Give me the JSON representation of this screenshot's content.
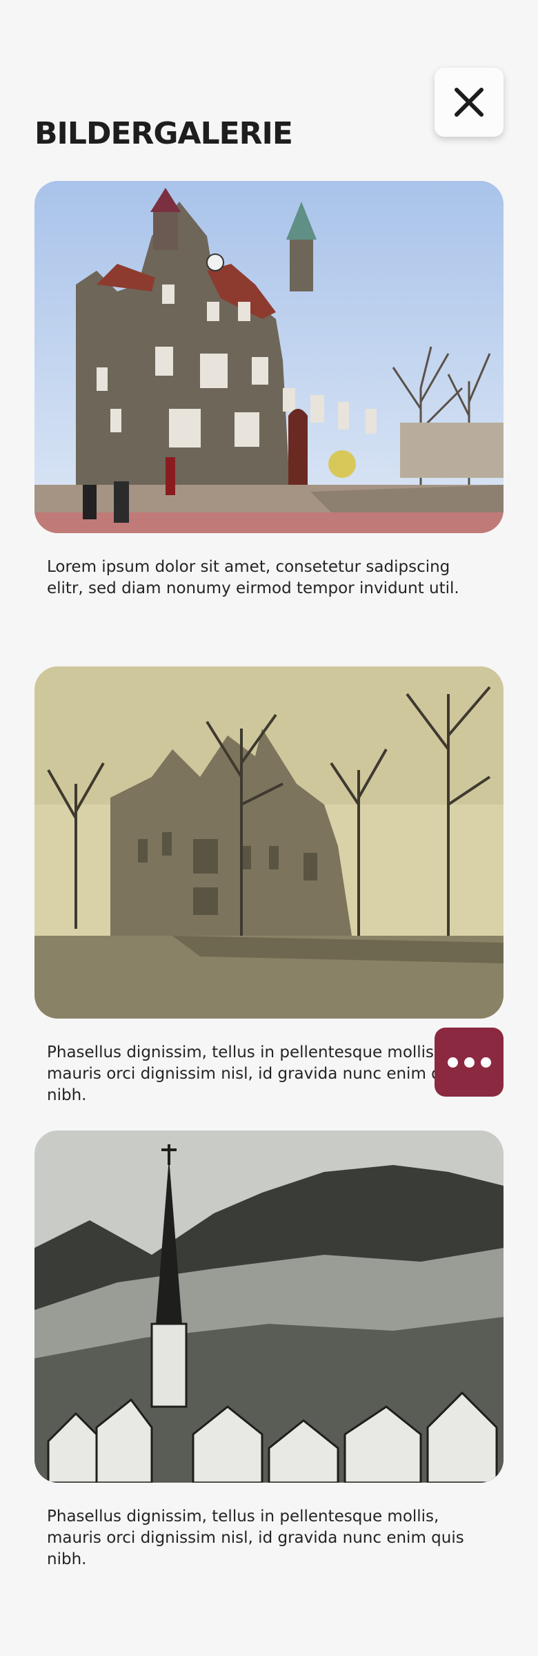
{
  "gallery": {
    "title": "BILDERGALERIE",
    "close_icon": "close-icon",
    "more_icon": "more-horizontal-icon",
    "accent_color": "#8b2940",
    "items": [
      {
        "caption": "Lorem ipsum dolor sit amet, consetetur sadipscing elitr, sed diam nonumy eirmod tempor invidunt util."
      },
      {
        "caption": "Phasellus dignissim, tellus in pellentesque mollis, mauris orci dignissim nisl, id gravida nunc enim quis nibh."
      },
      {
        "caption": "Phasellus dignissim, tellus in pellentesque mollis, mauris orci dignissim nisl, id gravida nunc enim quis nibh."
      }
    ]
  }
}
